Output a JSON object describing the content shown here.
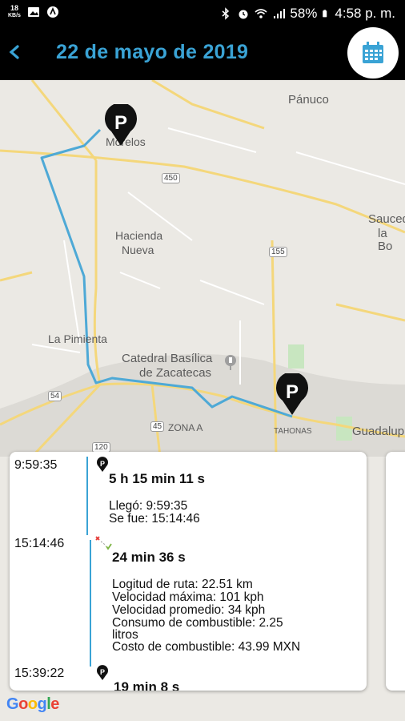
{
  "status_bar": {
    "speed_value": "18",
    "speed_unit": "KB/s",
    "battery": "58%",
    "clock": "4:58 p. m."
  },
  "header": {
    "back_icon": "chevron-left-icon",
    "title": "22 de mayo de 2019",
    "calendar_icon": "calendar-icon"
  },
  "colors": {
    "accent": "#3aa3d5",
    "header_bg": "#000000",
    "route": "#4ea9d6"
  },
  "map": {
    "labels": {
      "panuco": "Pánuco",
      "morelos": "Morelos",
      "sauceda_1": "Sauced",
      "sauceda_2": "la Bo",
      "hacienda_1": "Hacienda",
      "hacienda_2": "Nueva",
      "pimienta": "La Pimienta",
      "catedral_1": "Catedral Basílica",
      "catedral_2": "de Zacatecas",
      "zona_a": "ZONA A",
      "tahonas": "TAHONAS",
      "guadalupe": "Guadalup"
    },
    "shields": {
      "r450": "450",
      "r155": "155",
      "r54": "54",
      "r45": "45",
      "r120": "120"
    },
    "google": "Google"
  },
  "timeline": {
    "stop1": {
      "time": "9:59:35",
      "duration": "5 h 15 min 11 s",
      "arrived": "Llegó: 9:59:35",
      "left": "Se fue: 15:14:46"
    },
    "trip": {
      "time": "15:14:46",
      "duration": "24 min 36 s",
      "route_length": "Logitud de ruta:  22.51 km",
      "max_speed": "Velocidad máxima:  101 kph",
      "avg_speed": "Velocidad promedio:  34 kph",
      "fuel_1": "Consumo de combustible:  2.25",
      "fuel_2": "litros",
      "fuel_cost": "Costo de combustible:  43.99 MXN"
    },
    "stop2": {
      "time": "15:39:22",
      "duration": "19 min 8 s"
    }
  }
}
